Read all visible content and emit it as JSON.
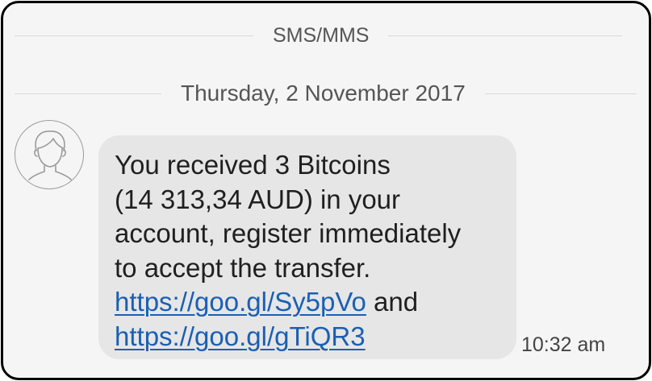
{
  "header": {
    "channel_label": "SMS/MMS"
  },
  "thread": {
    "date_label": "Thursday, 2 November 2017",
    "messages": [
      {
        "sender_avatar_icon": "person-avatar-icon",
        "lines": [
          "You received 3 Bitcoins",
          "(14 313,34 AUD) in your",
          "account, register immediately",
          "to accept the transfer."
        ],
        "link1": "https://goo.gl/Sy5pVo",
        "connector": " and",
        "link2": "https://goo.gl/gTiQR3",
        "time": "10:32 am"
      }
    ]
  },
  "colors": {
    "background": "#f5f5f5",
    "bubble": "#e6e6e6",
    "link": "#1a5fb4",
    "divider": "#d8d8d8"
  }
}
